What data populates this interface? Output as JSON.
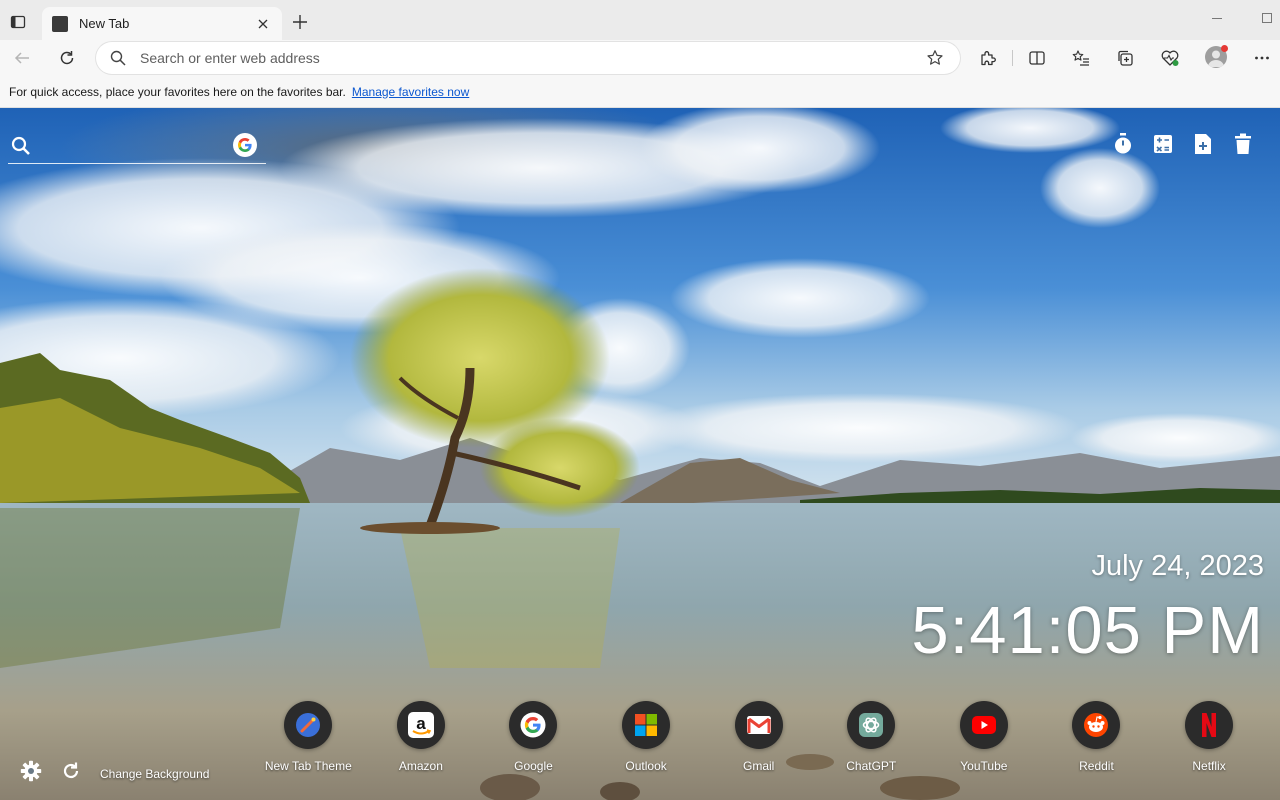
{
  "browser": {
    "tab_title": "New Tab",
    "omnibox_placeholder": "Search or enter web address"
  },
  "favorites_bar": {
    "text": "For quick access, place your favorites here on the favorites bar.",
    "link": "Manage favorites now"
  },
  "newtab": {
    "search_placeholder": "",
    "date": "July 24, 2023",
    "time": "5:41:05 PM",
    "change_background": "Change Background",
    "shortcuts": [
      {
        "label": "New Tab Theme",
        "icon": "new-tab-theme-icon"
      },
      {
        "label": "Amazon",
        "icon": "amazon-icon"
      },
      {
        "label": "Google",
        "icon": "google-icon"
      },
      {
        "label": "Outlook",
        "icon": "outlook-icon"
      },
      {
        "label": "Gmail",
        "icon": "gmail-icon"
      },
      {
        "label": "ChatGPT",
        "icon": "chatgpt-icon"
      },
      {
        "label": "YouTube",
        "icon": "youtube-icon"
      },
      {
        "label": "Reddit",
        "icon": "reddit-icon"
      },
      {
        "label": "Netflix",
        "icon": "netflix-icon"
      }
    ]
  },
  "colors": {
    "link": "#0b57d0",
    "youtube": "#ff0000",
    "netflix": "#e50914",
    "reddit": "#ff4500"
  }
}
